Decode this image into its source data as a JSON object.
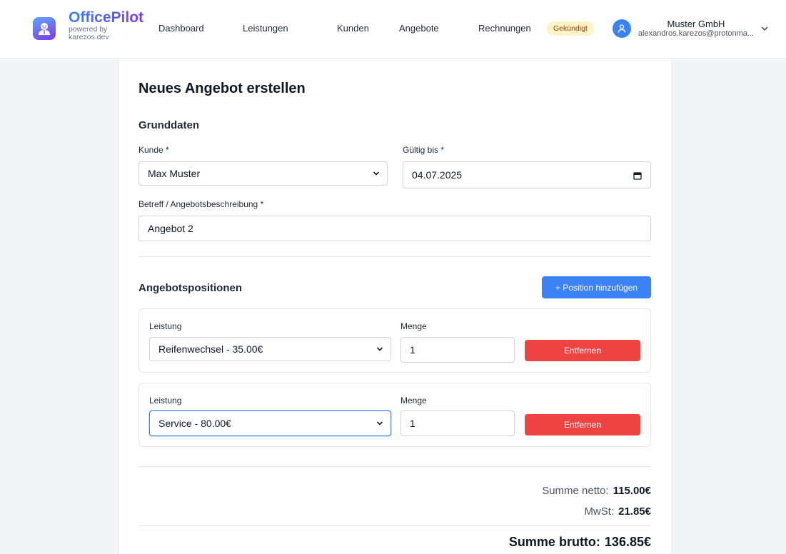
{
  "header": {
    "brand": "OfficePilot",
    "brand_sub": "powered by karezos.dev",
    "nav": [
      "Dashboard",
      "Leistungen",
      "Kunden",
      "Angebote",
      "Rechnungen"
    ],
    "badge": "Gekündigt",
    "user_name": "Muster GmbH",
    "user_email": "alexandros.karezos@protonma..."
  },
  "page": {
    "title": "Neues Angebot erstellen",
    "section_basic": "Grunddaten",
    "customer_label": "Kunde *",
    "customer_value": "Max Muster",
    "valid_label": "Gültig bis *",
    "valid_value": "04.07.2025",
    "subject_label": "Betreff / Angebotsbeschreibung *",
    "subject_value": "Angebot 2",
    "section_positions": "Angebotspositionen",
    "add_position": "+ Position hinzufügen",
    "positions": [
      {
        "service_label": "Leistung",
        "service_value": "Reifenwechsel - 35.00€",
        "qty_label": "Menge",
        "qty_value": "1",
        "remove": "Entfernen"
      },
      {
        "service_label": "Leistung",
        "service_value": "Service - 80.00€",
        "qty_label": "Menge",
        "qty_value": "1",
        "remove": "Entfernen"
      }
    ],
    "totals": {
      "net_label": "Summe netto:",
      "net_value": "115.00€",
      "vat_label": "MwSt:",
      "vat_value": "21.85€",
      "gross_label": "Summe brutto:",
      "gross_value": "136.85€"
    }
  },
  "colors": {
    "primary": "#3b82f6",
    "danger": "#ef4444",
    "badge_bg": "#fef3c7"
  }
}
